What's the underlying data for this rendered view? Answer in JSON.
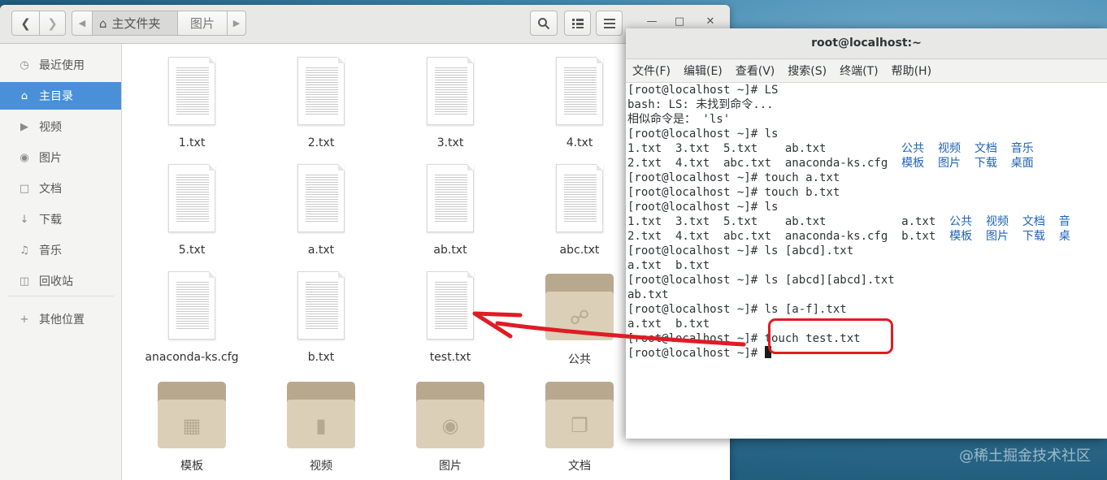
{
  "file_manager": {
    "breadcrumb": {
      "home": "主文件夹",
      "current": "图片"
    },
    "sidebar": [
      {
        "label": "最近使用",
        "icon": "clock-icon"
      },
      {
        "label": "主目录",
        "icon": "home-icon",
        "active": true
      },
      {
        "label": "视频",
        "icon": "video-icon"
      },
      {
        "label": "图片",
        "icon": "camera-icon"
      },
      {
        "label": "文档",
        "icon": "document-icon"
      },
      {
        "label": "下载",
        "icon": "download-icon"
      },
      {
        "label": "音乐",
        "icon": "music-icon"
      },
      {
        "label": "回收站",
        "icon": "trash-icon"
      },
      {
        "label": "其他位置",
        "icon": "plus-icon"
      }
    ],
    "items": [
      {
        "name": "1.txt",
        "kind": "text"
      },
      {
        "name": "2.txt",
        "kind": "text"
      },
      {
        "name": "3.txt",
        "kind": "text"
      },
      {
        "name": "4.txt",
        "kind": "text"
      },
      {
        "name": "5.txt",
        "kind": "text"
      },
      {
        "name": "a.txt",
        "kind": "text"
      },
      {
        "name": "ab.txt",
        "kind": "text"
      },
      {
        "name": "abc.txt",
        "kind": "text"
      },
      {
        "name": "anaconda-ks.cfg",
        "kind": "text"
      },
      {
        "name": "b.txt",
        "kind": "text"
      },
      {
        "name": "test.txt",
        "kind": "text"
      },
      {
        "name": "公共",
        "kind": "folder",
        "emblem": "share-icon"
      },
      {
        "name": "模板",
        "kind": "folder",
        "emblem": "template-icon"
      },
      {
        "name": "视频",
        "kind": "folder",
        "emblem": "video-icon"
      },
      {
        "name": "图片",
        "kind": "folder",
        "emblem": "camera-icon"
      },
      {
        "name": "文档",
        "kind": "folder",
        "emblem": "document-icon"
      }
    ]
  },
  "terminal": {
    "title": "root@localhost:~",
    "menu": [
      "文件(F)",
      "编辑(E)",
      "查看(V)",
      "搜索(S)",
      "终端(T)",
      "帮助(H)"
    ],
    "lines": [
      "[root@localhost ~]# LS",
      "bash: LS: 未找到命令...",
      "相似命令是： 'ls'",
      "[root@localhost ~]# ls",
      "1.txt  3.txt  5.txt    ab.txt           |公共  视频  文档  音乐",
      "2.txt  4.txt  abc.txt  anaconda-ks.cfg  |模板  图片  下载  桌面",
      "[root@localhost ~]# touch a.txt",
      "[root@localhost ~]# touch b.txt",
      "[root@localhost ~]# ls",
      "1.txt  3.txt  5.txt    ab.txt           a.txt  |公共  视频  文档  音",
      "2.txt  4.txt  abc.txt  anaconda-ks.cfg  b.txt  |模板  图片  下载  桌",
      "[root@localhost ~]# ls [abcd].txt",
      "a.txt  b.txt",
      "[root@localhost ~]# ls [abcd][abcd].txt",
      "ab.txt",
      "[root@localhost ~]# ls [a-f].txt",
      "a.txt  b.txt",
      "[root@localhost ~]# touch test.txt",
      "[root@localhost ~]# "
    ]
  },
  "watermark": "@稀土掘金技术社区",
  "colors": {
    "selection": "#4a90d9",
    "terminal_dir": "#1e63b8",
    "annotation": "#e01b24"
  }
}
